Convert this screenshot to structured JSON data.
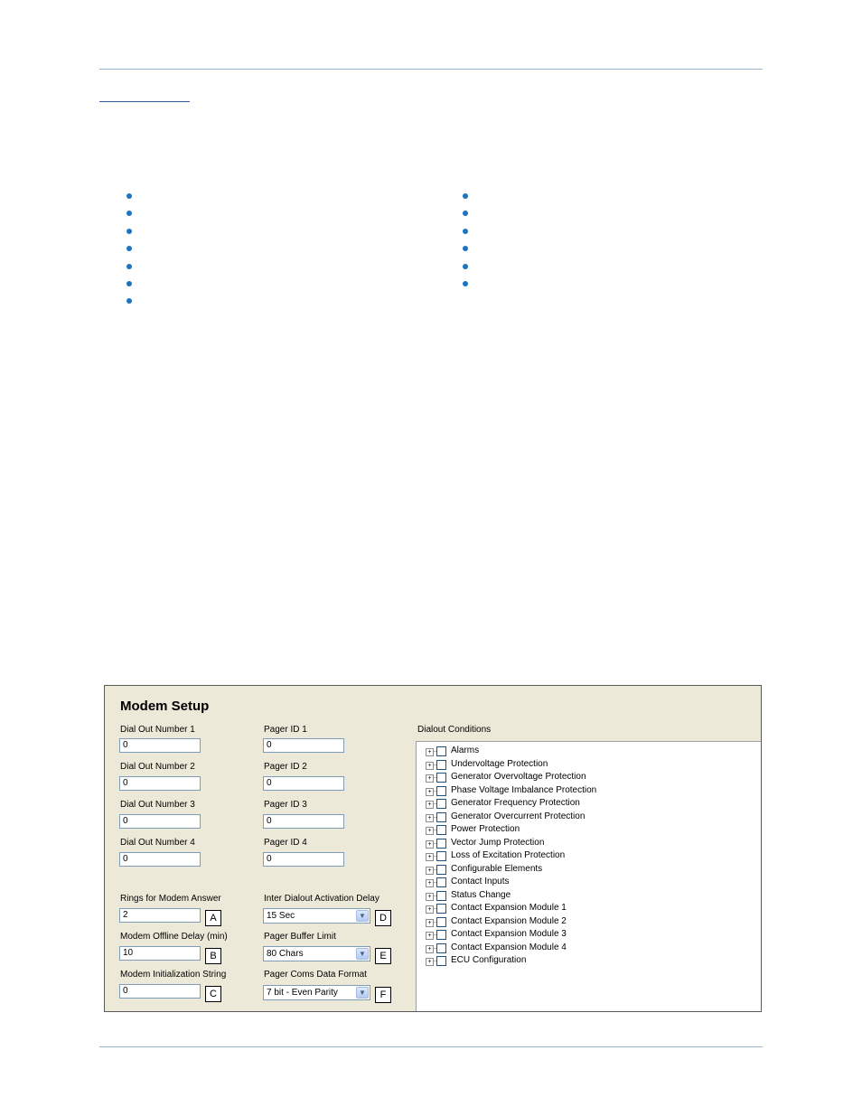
{
  "panel": {
    "title": "Modem Setup",
    "dial_out": [
      {
        "label": "Dial Out Number 1",
        "value": "0"
      },
      {
        "label": "Dial Out Number 2",
        "value": "0"
      },
      {
        "label": "Dial Out Number 3",
        "value": "0"
      },
      {
        "label": "Dial Out Number 4",
        "value": "0"
      }
    ],
    "pager_ids": [
      {
        "label": "Pager ID 1",
        "value": "0"
      },
      {
        "label": "Pager ID 2",
        "value": "0"
      },
      {
        "label": "Pager ID 3",
        "value": "0"
      },
      {
        "label": "Pager ID 4",
        "value": "0"
      }
    ],
    "rings": {
      "label": "Rings for Modem Answer",
      "value": "2",
      "callout": "A"
    },
    "offline_delay": {
      "label": "Modem Offline Delay (min)",
      "value": "10",
      "callout": "B"
    },
    "init_string": {
      "label": "Modem Initialization String",
      "value": "0",
      "callout": "C"
    },
    "dialout_delay": {
      "label": "Inter Dialout Activation Delay",
      "value": "15 Sec",
      "callout": "D"
    },
    "buffer_limit": {
      "label": "Pager Buffer Limit",
      "value": "80 Chars",
      "callout": "E"
    },
    "data_format": {
      "label": "Pager Coms Data Format",
      "value": "7 bit - Even Parity",
      "callout": "F"
    },
    "dialout_conditions": {
      "label": "Dialout Conditions",
      "items": [
        "Alarms",
        "Undervoltage Protection",
        "Generator Overvoltage Protection",
        "Phase Voltage Imbalance Protection",
        "Generator Frequency Protection",
        "Generator Overcurrent Protection",
        "Power Protection",
        "Vector Jump Protection",
        "Loss of Excitation Protection",
        "Configurable Elements",
        "Contact Inputs",
        "Status Change",
        "Contact Expansion Module 1",
        "Contact Expansion Module 2",
        "Contact Expansion Module 3",
        "Contact Expansion Module 4",
        "ECU Configuration"
      ]
    }
  }
}
